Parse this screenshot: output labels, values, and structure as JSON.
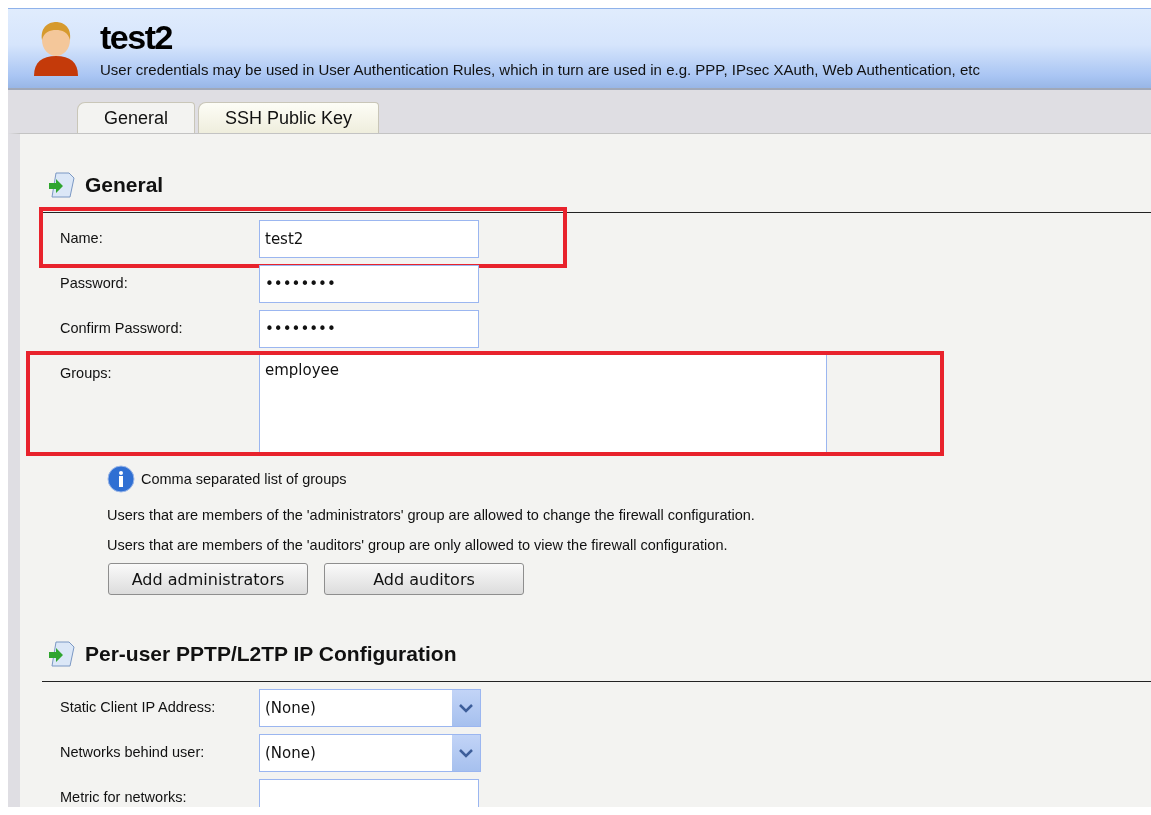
{
  "header": {
    "title": "test2",
    "subtitle": "User credentials may be used in User Authentication Rules, which in turn are used in e.g. PPP, IPsec XAuth, Web Authentication, etc"
  },
  "tabs": [
    {
      "label": "General",
      "selected": true
    },
    {
      "label": "SSH Public Key",
      "selected": false
    }
  ],
  "sections": [
    {
      "title": "General",
      "fields": [
        {
          "kind": "text",
          "label": "Name:",
          "value": "test2",
          "highlighted": true
        },
        {
          "kind": "password",
          "label": "Password:",
          "value": "••••••••",
          "highlighted": false
        },
        {
          "kind": "password",
          "label": "Confirm Password:",
          "value": "••••••••",
          "highlighted": false
        },
        {
          "kind": "textarea",
          "label": "Groups:",
          "value": "employee",
          "highlighted": true
        }
      ],
      "info": "Comma separated list of groups",
      "notes": [
        "Users that are members of the 'administrators' group are allowed to change the firewall configuration.",
        "Users that are members of the 'auditors' group are only allowed to view the firewall configuration."
      ],
      "buttons": [
        "Add administrators",
        "Add auditors"
      ]
    },
    {
      "title": "Per-user PPTP/L2TP IP Configuration",
      "fields": [
        {
          "kind": "select",
          "label": "Static Client IP Address:",
          "value": "(None)",
          "highlighted": false
        },
        {
          "kind": "select",
          "label": "Networks behind user:",
          "value": "(None)",
          "highlighted": false
        },
        {
          "kind": "text",
          "label": "Metric for networks:",
          "highlighted": false
        }
      ]
    }
  ]
}
